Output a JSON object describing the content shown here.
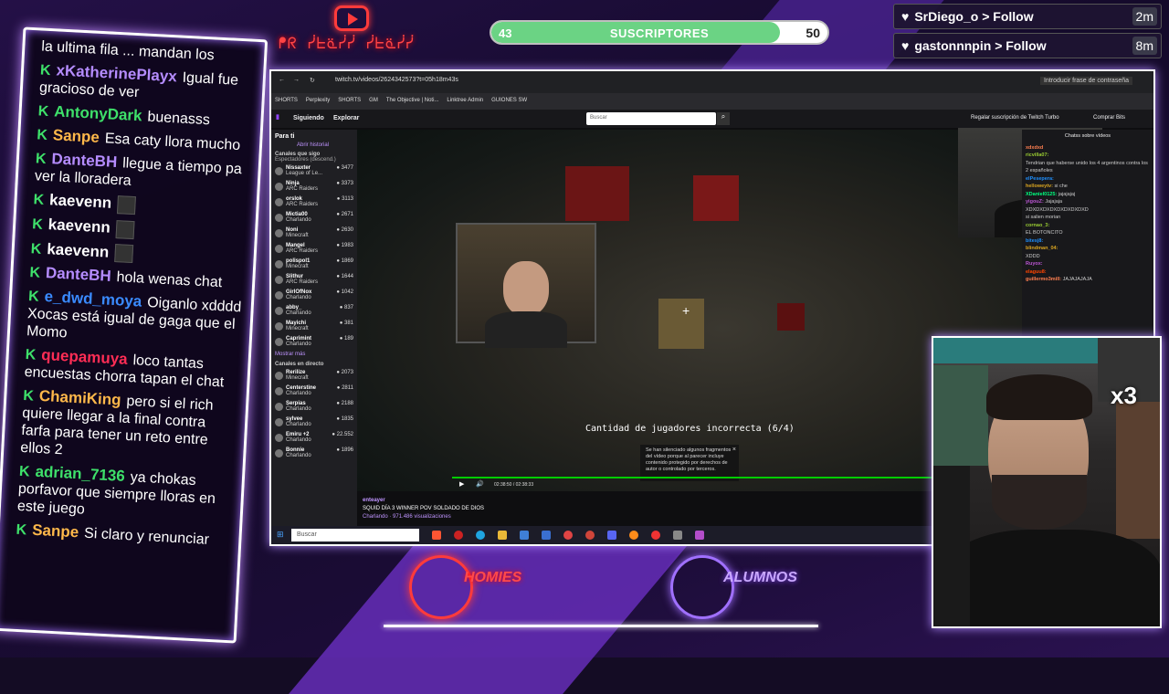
{
  "overlay": {
    "neon_text": "ᖰᖇ ᓰᖶᓏᓰᓰ ᓰᖶᓏᓰᓰ",
    "subs": {
      "current": "43",
      "label": "SUSCRIPTORES",
      "goal": "50",
      "progress_pct": 86
    },
    "follows": [
      {
        "text": "SrDiego_o > Follow",
        "time": "2m"
      },
      {
        "text": "gastonnnpin > Follow",
        "time": "8m"
      }
    ],
    "logos": {
      "left": "HOMIES",
      "right": "ALUMNOS"
    },
    "multiplier": "x3"
  },
  "chat": [
    {
      "user": "",
      "text": "la ultima fila ... mandan los",
      "color": "#ffffff"
    },
    {
      "user": "xKatherinePlayx",
      "text": "Igual fue gracioso de ver",
      "color": "#b58cff"
    },
    {
      "user": "AntonyDark",
      "text": "buenasss",
      "color": "#3ee06a"
    },
    {
      "user": "Sanpe",
      "text": "Esa caty llora mucho",
      "color": "#ffb84a"
    },
    {
      "user": "DanteBH",
      "text": "llegue a tiempo pa ver la lloradera",
      "color": "#b58cff"
    },
    {
      "user": "kaevenn",
      "text": "",
      "color": "#ffffff"
    },
    {
      "user": "kaevenn",
      "text": "",
      "color": "#ffffff"
    },
    {
      "user": "kaevenn",
      "text": "",
      "color": "#ffffff"
    },
    {
      "user": "DanteBH",
      "text": "hola wenas chat",
      "color": "#b58cff"
    },
    {
      "user": "e_dwd_moya",
      "text": "Oiganlo xdddd Xocas está igual de gaga que el Momo",
      "color": "#3a8bff"
    },
    {
      "user": "quepamuya",
      "text": "loco tantas encuestas chorra tapan el chat",
      "color": "#ff2d55"
    },
    {
      "user": "ChamiKing",
      "text": "pero si el rich quiere llegar a la final contra farfa para tener un reto entre ellos 2",
      "color": "#ffb84a"
    },
    {
      "user": "adrian_7136",
      "text": "ya chokas porfavor que siempre lloras en este juego",
      "color": "#3ee06a"
    },
    {
      "user": "Sanpe",
      "text": "Si claro y renunciar",
      "color": "#ffb84a"
    }
  ],
  "browser": {
    "url": "twitch.tv/videos/2624342573?t=05h18m43s",
    "password_hint": "Introducir frase de contraseña",
    "bookmarks": [
      "SHORTS",
      "Perplexity",
      "SHORTS",
      "GM",
      "The Objective | Noti...",
      "Linktree Admin",
      "GUIONES SW"
    ],
    "twitch": {
      "nav_following": "Siguiendo",
      "nav_explore": "Explorar",
      "search_placeholder": "Buscar",
      "turbo": "Regalar suscripción de Twitch Turbo",
      "bits": "Comprar Bits",
      "sidebar_title": "Para ti",
      "sidebar_history": "Abrir historial",
      "sidebar_followed": "Canales que sigo",
      "sidebar_followed_sub": "Espectadores (descend.)",
      "channels": [
        {
          "name": "Nissaxter",
          "game": "League of Le...",
          "viewers": "3477"
        },
        {
          "name": "Ninja",
          "game": "ARC Raiders",
          "viewers": "3373"
        },
        {
          "name": "orslok",
          "game": "ARC Raiders",
          "viewers": "3113"
        },
        {
          "name": "Mictia00",
          "game": "Charlando",
          "viewers": "2671"
        },
        {
          "name": "Noni",
          "game": "Minecraft",
          "viewers": "2630"
        },
        {
          "name": "Mangel",
          "game": "ARC Raiders",
          "viewers": "1983"
        },
        {
          "name": "polispol1",
          "game": "Minecraft",
          "viewers": "1869"
        },
        {
          "name": "Slithur",
          "game": "ARC Raiders",
          "viewers": "1644"
        },
        {
          "name": "GirlOfNox",
          "game": "Charlando",
          "viewers": "1042"
        },
        {
          "name": "abby_",
          "game": "Charlando",
          "viewers": "837"
        },
        {
          "name": "Mayichi",
          "game": "Minecraft",
          "viewers": "381"
        },
        {
          "name": "Caprimint",
          "game": "Charlando",
          "viewers": "189"
        }
      ],
      "show_more": "Mostrar más",
      "live_title": "Canales en directo",
      "live": [
        {
          "name": "Rerilize",
          "game": "Minecraft",
          "viewers": "2073"
        },
        {
          "name": "Centerstine",
          "game": "Charlando",
          "viewers": "2811"
        },
        {
          "name": "Serpias",
          "game": "Charlando",
          "viewers": "2188"
        },
        {
          "name": "sylvee",
          "game": "Charlando",
          "viewers": "1835"
        },
        {
          "name": "Emiru +2",
          "game": "Charlando",
          "viewers": "22.552"
        },
        {
          "name": "Bonnie",
          "game": "Charlando",
          "viewers": "1896"
        }
      ],
      "game_text": "Cantidad de jugadores incorrecta (6/4)",
      "notice": "Se han silenciado algunos fragmentos del vídeo porque al parecer incluye contenido protegido por derechos de autor o controlado por terceros.",
      "time": "02:38:50 / 02:38:33",
      "right_chat_title": "Chatss sobre vídeos",
      "right_chat": [
        {
          "u": "xdxdxd",
          "t": ""
        },
        {
          "u": "ricvilla07:",
          "t": ""
        },
        {
          "u": "",
          "t": "Tendrian que haberse unido los 4 argentinos contra los 2 españoles"
        },
        {
          "u": "elPesepera:",
          "t": ""
        },
        {
          "u": "helloweytv:",
          "t": "si che"
        },
        {
          "u": "XDaniel0125:",
          "t": "jajajajaj"
        },
        {
          "u": "yigouZ:",
          "t": "Jajajaja"
        },
        {
          "u": "",
          "t": "XDXDXDXDXDXDXDXDXD"
        },
        {
          "u": "",
          "t": "si salien morian"
        },
        {
          "u": "cornao_3:",
          "t": ""
        },
        {
          "u": "",
          "t": "EL BOTONCITO"
        },
        {
          "u": "bitesj8:",
          "t": ""
        },
        {
          "u": "blindman_04:",
          "t": ""
        },
        {
          "u": "",
          "t": "XDDD"
        },
        {
          "u": "Ruyox:",
          "t": ""
        },
        {
          "u": "elaguu8:",
          "t": ""
        },
        {
          "u": "guillermo3mill:",
          "t": "JAJAJAJAJA"
        }
      ],
      "streamer": "enteayer",
      "title": "SQUID DÍA 3 WINNER POV SOLDADO DE DIOS",
      "category": "Charlando · 971.486 visualizaciones"
    },
    "taskbar_search": "Buscar"
  }
}
